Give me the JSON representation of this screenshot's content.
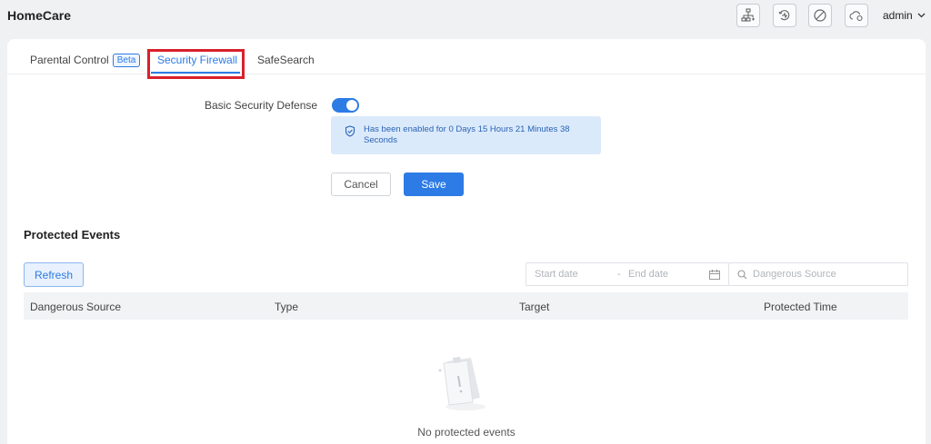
{
  "app": {
    "title": "HomeCare"
  },
  "header": {
    "icons": [
      "network-topology-icon",
      "diagnostics-icon",
      "blocked-icon",
      "cloud-settings-icon"
    ],
    "user": "admin"
  },
  "tabs": [
    {
      "label": "Parental Control",
      "badge": "Beta"
    },
    {
      "label": "Security Firewall",
      "active": true
    },
    {
      "label": "SafeSearch"
    }
  ],
  "security": {
    "label": "Basic Security Defense",
    "enabled": true,
    "status_text": "Has been enabled for 0 Days 15 Hours 21 Minutes 38 Seconds",
    "cancel_label": "Cancel",
    "save_label": "Save"
  },
  "events": {
    "title": "Protected Events",
    "refresh_label": "Refresh",
    "start_date_placeholder": "Start date",
    "date_separator": "-",
    "end_date_placeholder": "End date",
    "search_placeholder": "Dangerous Source",
    "columns": [
      "Dangerous Source",
      "Type",
      "Target",
      "Protected Time"
    ],
    "rows": [],
    "empty_text": "No protected events"
  },
  "colors": {
    "accent": "#2d7be5",
    "highlight": "#d9202a",
    "info_bg": "#dbeafb"
  }
}
